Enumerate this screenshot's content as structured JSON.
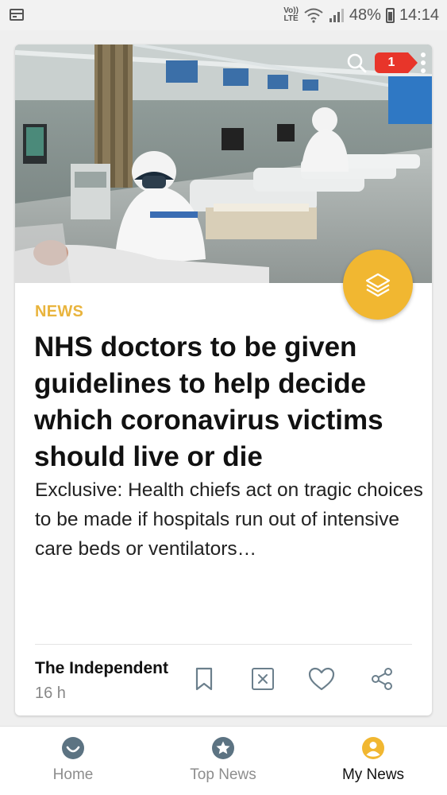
{
  "status_bar": {
    "volte_top": "Vo))",
    "volte_bottom": "LTE",
    "battery": "48%",
    "time": "14:14"
  },
  "article": {
    "notification_count": "1",
    "category": "NEWS",
    "headline": "NHS doctors to be given guidelines to help decide which coronavirus victims should live or die",
    "summary": "Exclusive: Health chiefs act on tragic choices to be made if hospitals run out of intensive care beds or ventilators…",
    "source": "The Independent",
    "age": "16 h",
    "accent_color": "#f1b731",
    "badge_color": "#e8352a"
  },
  "icons": {
    "search": "search-icon",
    "menu": "more-vert-icon",
    "fab": "layers-icon",
    "bookmark": "bookmark-icon",
    "hide": "close-box-icon",
    "like": "heart-icon",
    "share": "share-icon"
  },
  "bottom_nav": {
    "items": [
      {
        "label": "Home",
        "icon": "smiley-icon",
        "active": false
      },
      {
        "label": "Top News",
        "icon": "star-circle-icon",
        "active": false
      },
      {
        "label": "My News",
        "icon": "user-circle-icon",
        "active": true
      }
    ],
    "active_color": "#f1b731",
    "inactive_color": "#5c7382"
  }
}
